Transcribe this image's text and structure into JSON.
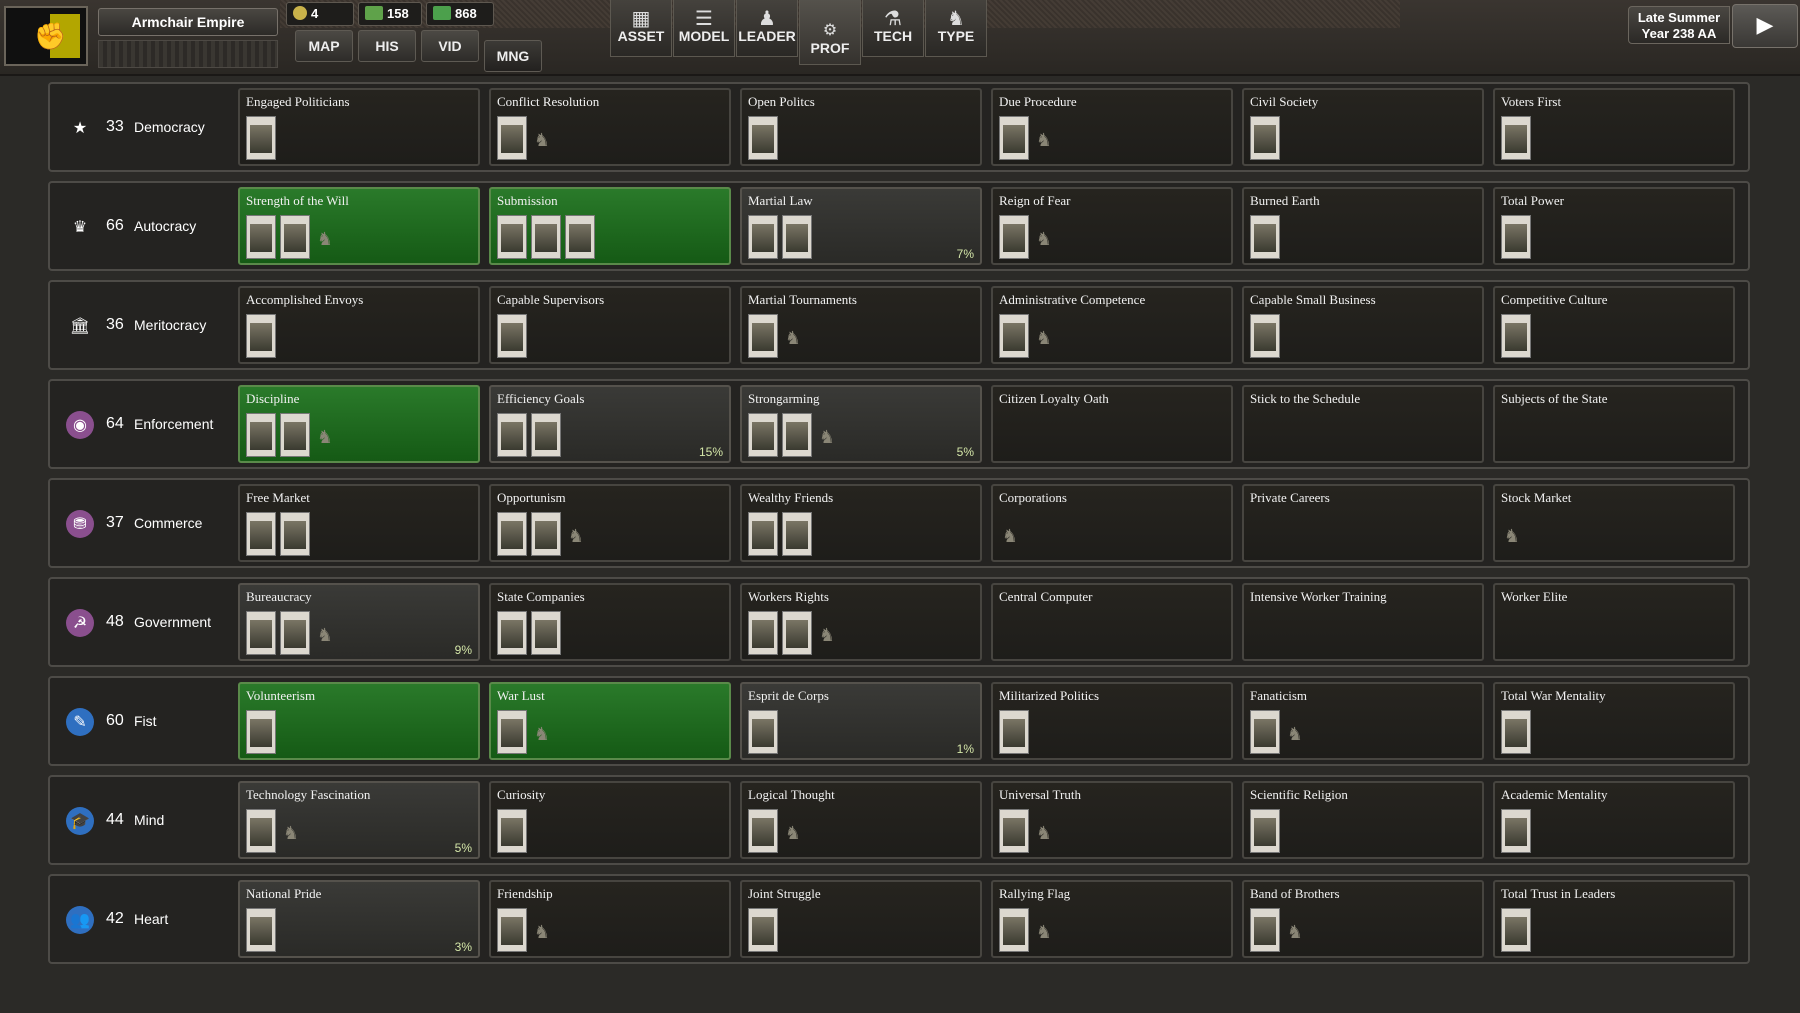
{
  "header": {
    "nation_name": "Armchair Empire",
    "resources": [
      "4",
      "158",
      "868"
    ],
    "small_tabs": [
      "MAP",
      "HIS",
      "VID",
      "MNG"
    ],
    "big_tabs": [
      "ASSET",
      "MODEL",
      "LEADER",
      "PROF",
      "TECH",
      "TYPE"
    ],
    "active_big_tab": "PROF",
    "season": "Late Summer",
    "year": "Year 238 AA"
  },
  "rows": [
    {
      "name": "Democracy",
      "score": "33",
      "icon": "star-icon",
      "icon_glyph": "★",
      "icon_bg": "transparent",
      "cards": [
        {
          "title": "Engaged Politicians",
          "state": "none",
          "pct": "",
          "thumbs": 1,
          "units": 0
        },
        {
          "title": "Conflict Resolution",
          "state": "none",
          "pct": "",
          "thumbs": 1,
          "units": 1
        },
        {
          "title": "Open Politcs",
          "state": "none",
          "pct": "",
          "thumbs": 1,
          "units": 0
        },
        {
          "title": "Due Procedure",
          "state": "none",
          "pct": "",
          "thumbs": 1,
          "units": 1
        },
        {
          "title": "Civil Society",
          "state": "none",
          "pct": "",
          "thumbs": 1,
          "units": 0
        },
        {
          "title": "Voters First",
          "state": "none",
          "pct": "",
          "thumbs": 1,
          "units": 0
        }
      ]
    },
    {
      "name": "Autocracy",
      "score": "66",
      "icon": "crown-icon",
      "icon_glyph": "♛",
      "icon_bg": "transparent",
      "cards": [
        {
          "title": "Strength of the Will",
          "state": "active",
          "pct": "",
          "thumbs": 2,
          "units": 1
        },
        {
          "title": "Submission",
          "state": "active",
          "pct": "",
          "thumbs": 3,
          "units": 0
        },
        {
          "title": "Martial Law",
          "state": "partial",
          "pct": "7%",
          "thumbs": 2,
          "units": 0
        },
        {
          "title": "Reign of Fear",
          "state": "none",
          "pct": "",
          "thumbs": 1,
          "units": 1
        },
        {
          "title": "Burned Earth",
          "state": "none",
          "pct": "",
          "thumbs": 1,
          "units": 0
        },
        {
          "title": "Total Power",
          "state": "none",
          "pct": "",
          "thumbs": 1,
          "units": 0
        }
      ]
    },
    {
      "name": "Meritocracy",
      "score": "36",
      "icon": "institution-icon",
      "icon_glyph": "🏛",
      "icon_bg": "transparent",
      "cards": [
        {
          "title": "Accomplished Envoys",
          "state": "none",
          "pct": "",
          "thumbs": 1,
          "units": 0
        },
        {
          "title": "Capable Supervisors",
          "state": "none",
          "pct": "",
          "thumbs": 1,
          "units": 0
        },
        {
          "title": "Martial Tournaments",
          "state": "none",
          "pct": "",
          "thumbs": 1,
          "units": 1
        },
        {
          "title": "Administrative Competence",
          "state": "none",
          "pct": "",
          "thumbs": 1,
          "units": 1
        },
        {
          "title": "Capable Small Business",
          "state": "none",
          "pct": "",
          "thumbs": 1,
          "units": 0
        },
        {
          "title": "Competitive Culture",
          "state": "none",
          "pct": "",
          "thumbs": 1,
          "units": 0
        }
      ]
    },
    {
      "name": "Enforcement",
      "score": "64",
      "icon": "eye-icon",
      "icon_glyph": "◉",
      "icon_bg": "#8a4f8e",
      "cards": [
        {
          "title": "Discipline",
          "state": "active",
          "pct": "",
          "thumbs": 2,
          "units": 1
        },
        {
          "title": "Efficiency Goals",
          "state": "partial",
          "pct": "15%",
          "thumbs": 2,
          "units": 0
        },
        {
          "title": "Strongarming",
          "state": "partial",
          "pct": "5%",
          "thumbs": 2,
          "units": 1
        },
        {
          "title": "Citizen Loyalty Oath",
          "state": "none",
          "pct": "",
          "thumbs": 0,
          "units": 0
        },
        {
          "title": "Stick to the Schedule",
          "state": "none",
          "pct": "",
          "thumbs": 0,
          "units": 0
        },
        {
          "title": "Subjects of the State",
          "state": "none",
          "pct": "",
          "thumbs": 0,
          "units": 0
        }
      ]
    },
    {
      "name": "Commerce",
      "score": "37",
      "icon": "coins-icon",
      "icon_glyph": "⛃",
      "icon_bg": "#8a4f8e",
      "cards": [
        {
          "title": "Free Market",
          "state": "none",
          "pct": "",
          "thumbs": 2,
          "units": 0
        },
        {
          "title": "Opportunism",
          "state": "none",
          "pct": "",
          "thumbs": 2,
          "units": 1
        },
        {
          "title": "Wealthy Friends",
          "state": "none",
          "pct": "",
          "thumbs": 2,
          "units": 0
        },
        {
          "title": "Corporations",
          "state": "none",
          "pct": "",
          "thumbs": 0,
          "units": 1
        },
        {
          "title": "Private Careers",
          "state": "none",
          "pct": "",
          "thumbs": 0,
          "units": 0
        },
        {
          "title": "Stock Market",
          "state": "none",
          "pct": "",
          "thumbs": 0,
          "units": 1
        }
      ]
    },
    {
      "name": "Government",
      "score": "48",
      "icon": "hammer-sickle-icon",
      "icon_glyph": "☭",
      "icon_bg": "#8a4f8e",
      "cards": [
        {
          "title": "Bureaucracy",
          "state": "partial",
          "pct": "9%",
          "thumbs": 2,
          "units": 1
        },
        {
          "title": "State Companies",
          "state": "none",
          "pct": "",
          "thumbs": 2,
          "units": 0
        },
        {
          "title": "Workers Rights",
          "state": "none",
          "pct": "",
          "thumbs": 2,
          "units": 1
        },
        {
          "title": "Central Computer",
          "state": "none",
          "pct": "",
          "thumbs": 0,
          "units": 0
        },
        {
          "title": "Intensive Worker Training",
          "state": "none",
          "pct": "",
          "thumbs": 0,
          "units": 0
        },
        {
          "title": "Worker Elite",
          "state": "none",
          "pct": "",
          "thumbs": 0,
          "units": 0
        }
      ]
    },
    {
      "name": "Fist",
      "score": "60",
      "icon": "pen-icon",
      "icon_glyph": "✎",
      "icon_bg": "#2f6fc0",
      "cards": [
        {
          "title": "Volunteerism",
          "state": "active",
          "pct": "",
          "thumbs": 1,
          "units": 0
        },
        {
          "title": "War Lust",
          "state": "active",
          "pct": "",
          "thumbs": 1,
          "units": 1
        },
        {
          "title": "Esprit de Corps",
          "state": "partial",
          "pct": "1%",
          "thumbs": 1,
          "units": 0
        },
        {
          "title": "Militarized Politics",
          "state": "none",
          "pct": "",
          "thumbs": 1,
          "units": 0
        },
        {
          "title": "Fanaticism",
          "state": "none",
          "pct": "",
          "thumbs": 1,
          "units": 1
        },
        {
          "title": "Total War Mentality",
          "state": "none",
          "pct": "",
          "thumbs": 1,
          "units": 0
        }
      ]
    },
    {
      "name": "Mind",
      "score": "44",
      "icon": "graduation-cap-icon",
      "icon_glyph": "🎓",
      "icon_bg": "#2f6fc0",
      "cards": [
        {
          "title": "Technology Fascination",
          "state": "partial",
          "pct": "5%",
          "thumbs": 1,
          "units": 1
        },
        {
          "title": "Curiosity",
          "state": "none",
          "pct": "",
          "thumbs": 1,
          "units": 0
        },
        {
          "title": "Logical Thought",
          "state": "none",
          "pct": "",
          "thumbs": 1,
          "units": 1
        },
        {
          "title": "Universal Truth",
          "state": "none",
          "pct": "",
          "thumbs": 1,
          "units": 1
        },
        {
          "title": "Scientific Religion",
          "state": "none",
          "pct": "",
          "thumbs": 1,
          "units": 0
        },
        {
          "title": "Academic Mentality",
          "state": "none",
          "pct": "",
          "thumbs": 1,
          "units": 0
        }
      ]
    },
    {
      "name": "Heart",
      "score": "42",
      "icon": "people-icon",
      "icon_glyph": "👥",
      "icon_bg": "#2f6fc0",
      "cards": [
        {
          "title": "National Pride",
          "state": "partial",
          "pct": "3%",
          "thumbs": 1,
          "units": 0
        },
        {
          "title": "Friendship",
          "state": "none",
          "pct": "",
          "thumbs": 1,
          "units": 1
        },
        {
          "title": "Joint Struggle",
          "state": "none",
          "pct": "",
          "thumbs": 1,
          "units": 0
        },
        {
          "title": "Rallying Flag",
          "state": "none",
          "pct": "",
          "thumbs": 1,
          "units": 1
        },
        {
          "title": "Band of Brothers",
          "state": "none",
          "pct": "",
          "thumbs": 1,
          "units": 1
        },
        {
          "title": "Total Trust in Leaders",
          "state": "none",
          "pct": "",
          "thumbs": 1,
          "units": 0
        }
      ]
    }
  ]
}
